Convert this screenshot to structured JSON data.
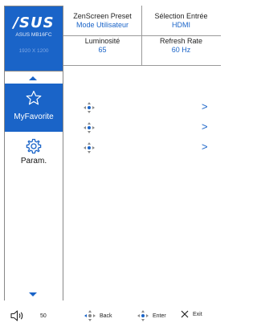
{
  "brand": {
    "logo": "/SUS",
    "model": "ASUS MB16FC",
    "resolution": "1920 X 1200",
    "accent": "#1a64c8"
  },
  "sidebar": {
    "items": [
      {
        "label": "MyFavorite",
        "icon": "star-outline-icon",
        "selected": true
      },
      {
        "label": "Param.",
        "icon": "gear-icon",
        "selected": false
      }
    ],
    "scroll_up_icon": "arrow-up-icon",
    "scroll_down_icon": "arrow-down-icon"
  },
  "header": {
    "cells": [
      {
        "title": "ZenScreen Preset",
        "value": "Mode Utilisateur"
      },
      {
        "title": "Sélection Entrée",
        "value": "HDMI"
      },
      {
        "title": "Luminosité",
        "value": "65"
      },
      {
        "title": "Refresh Rate",
        "value": "60 Hz"
      }
    ]
  },
  "rows": [
    {
      "icon": "navigate-icon",
      "chevron": ">"
    },
    {
      "icon": "navigate-icon",
      "chevron": ">"
    },
    {
      "icon": "navigate-icon",
      "chevron": ">"
    }
  ],
  "footer": {
    "volume_icon": "speaker-icon",
    "volume_value": "50",
    "back_label": "Back",
    "enter_label": "Enter",
    "exit_label": "Exit"
  }
}
